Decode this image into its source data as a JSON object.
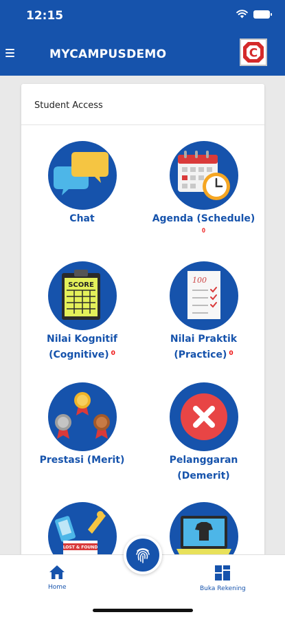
{
  "status": {
    "time": "12:15"
  },
  "header": {
    "title": "MYCAMPUSDEMO",
    "logo_letter": "C"
  },
  "card": {
    "title": "Student Access"
  },
  "tiles": [
    {
      "line1": "Chat",
      "line2": "",
      "badge": ""
    },
    {
      "line1": "Agenda (Schedule)",
      "line2": "",
      "badge": "0"
    },
    {
      "line1": "Nilai Kognitif",
      "line2": "(Cognitive)",
      "badge": "0"
    },
    {
      "line1": "Nilai Praktik",
      "line2": "(Practice)",
      "badge": "0"
    },
    {
      "line1": "Prestasi (Merit)",
      "line2": "",
      "badge": ""
    },
    {
      "line1": "Pelanggaran",
      "line2": "(Demerit)",
      "badge": ""
    },
    {
      "line1": "",
      "line2": "",
      "badge": "",
      "sign_text": "LOST & FOUND"
    },
    {
      "line1": "",
      "line2": "",
      "badge": ""
    }
  ],
  "score_sign": "SCORE",
  "practice_sheet_number": "100",
  "nav": {
    "home": "Home",
    "account": "Buka Rekening"
  },
  "colors": {
    "primary": "#1653ac",
    "badge": "#e11111",
    "demerit_red": "#e84545"
  }
}
